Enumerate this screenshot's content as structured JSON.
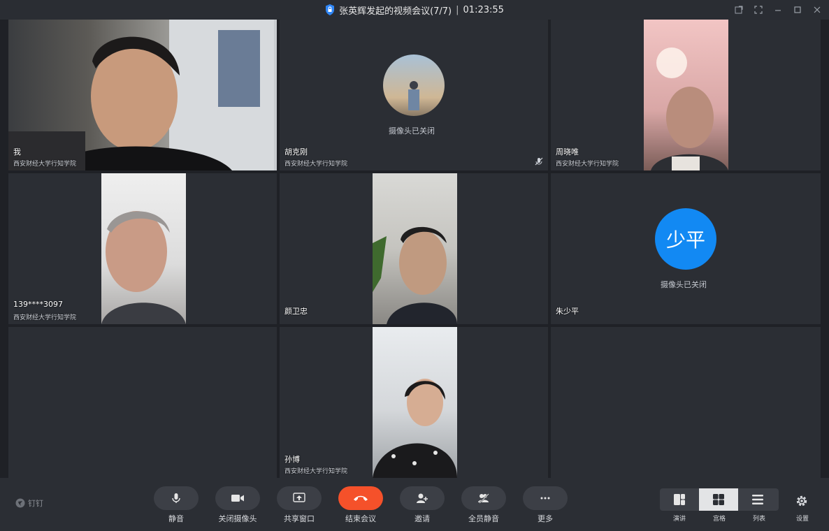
{
  "window": {
    "title": "张英辉发起的视频会议(7/7)",
    "separator": "|",
    "duration": "01:23:55"
  },
  "participants": [
    {
      "name": "我",
      "org": "西安财经大学行知学院",
      "camera": "on"
    },
    {
      "name": "胡克刚",
      "org": "西安财经大学行知学院",
      "camera": "off",
      "camera_off_text": "摄像头已关闭",
      "mic_muted": true
    },
    {
      "name": "周晓唯",
      "org": "西安财经大学行知学院",
      "camera": "on"
    },
    {
      "name": "139****3097",
      "org": "西安财经大学行知学院",
      "camera": "on"
    },
    {
      "name": "颜卫忠",
      "org": "",
      "camera": "on"
    },
    {
      "name": "朱少平",
      "org": "",
      "camera": "off",
      "camera_off_text": "摄像头已关闭",
      "avatar_text": "少平",
      "avatar_color": "#1289f3"
    },
    {
      "name": "孙博",
      "org": "西安财经大学行知学院",
      "camera": "on"
    }
  ],
  "toolbar": {
    "brand": "钉钉",
    "buttons": [
      {
        "label": "静音",
        "icon": "microphone-icon"
      },
      {
        "label": "关闭摄像头",
        "icon": "camera-icon"
      },
      {
        "label": "共享窗口",
        "icon": "share-screen-icon"
      },
      {
        "label": "结束会议",
        "icon": "hang-up-icon",
        "color": "#f5512a"
      },
      {
        "label": "邀请",
        "icon": "add-user-icon"
      },
      {
        "label": "全员静音",
        "icon": "mute-all-icon"
      },
      {
        "label": "更多",
        "icon": "more-icon"
      }
    ],
    "layouts": [
      {
        "label": "演讲",
        "icon": "speaker-layout-icon",
        "active": false
      },
      {
        "label": "宫格",
        "icon": "grid-layout-icon",
        "active": true
      },
      {
        "label": "列表",
        "icon": "list-layout-icon",
        "active": false
      }
    ],
    "settings_label": "设置"
  }
}
